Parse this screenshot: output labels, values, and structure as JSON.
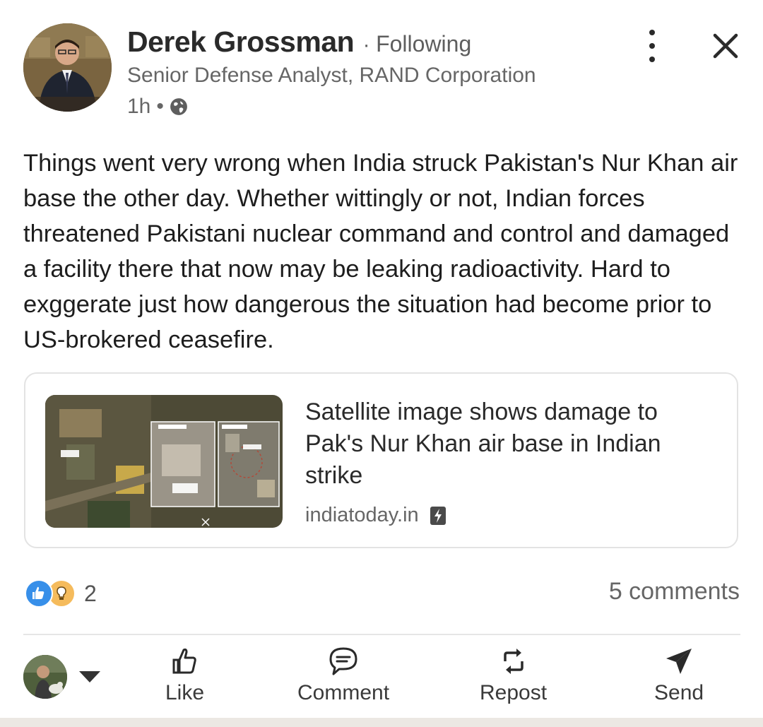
{
  "post": {
    "author": {
      "name": "Derek Grossman",
      "separator": "·",
      "follow_status": "Following",
      "headline": "Senior Defense Analyst, RAND Corporation",
      "time": "1h",
      "time_separator": "•",
      "visibility_icon": "globe-icon"
    },
    "body": "Things went very wrong when India struck Pakistan's Nur Khan air base the other day. Whether wittingly or not, Indian forces threatened Pakistani nuclear command and control and damaged a facility there that now may be leaking radioactivity. Hard to exggerate just how dangerous the situation had become prior to US-brokered ceasefire.",
    "link": {
      "title": "Satellite image shows damage to Pak's Nur Khan air base in Indian strike",
      "source": "indiatoday.in",
      "source_icon": "amp-lightning-icon"
    },
    "social": {
      "reaction_icons": [
        "like-reaction-icon",
        "insightful-reaction-icon"
      ],
      "reaction_count": "2",
      "comments": "5 comments"
    }
  },
  "actions": {
    "like": "Like",
    "comment": "Comment",
    "repost": "Repost",
    "send": "Send"
  },
  "colors": {
    "like_reaction": "#378fe9",
    "insightful_reaction": "#f5bb5c",
    "text_primary": "#1d1d1d",
    "text_secondary": "#666666"
  }
}
